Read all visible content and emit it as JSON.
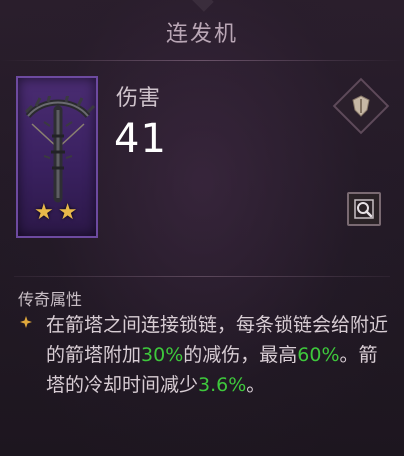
{
  "header": {
    "title": "连发机"
  },
  "item": {
    "stars": 2,
    "stat_label": "伤害",
    "stat_value": "41"
  },
  "legendary": {
    "label": "传奇属性",
    "text_1": "在箭塔之间连接锁链，每条锁链会给附近的箭塔附加",
    "value_1": "30%",
    "text_2": "的减伤，最高",
    "value_2": "60%",
    "text_3": "。箭塔的冷却时间减少",
    "value_3": "3.6%",
    "text_4": "。"
  },
  "colors": {
    "highlight": "#3ec83c",
    "item_frame": "#4a2c72",
    "star": "#e8b84a"
  },
  "icons": {
    "item": "crossbow-icon",
    "slot": "shield-slot-icon",
    "inspect": "inspect-icon",
    "bullet": "diamond-bullet-icon",
    "star": "star-icon"
  }
}
